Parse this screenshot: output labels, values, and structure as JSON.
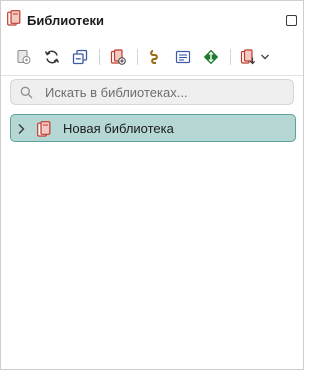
{
  "header": {
    "title": "Библиотеки",
    "icon": "library-books-icon"
  },
  "toolbar": {
    "icons": [
      "library-properties-icon",
      "sync-icon",
      "collapse-all-icon",
      "new-library-icon",
      "link-icon",
      "text-block-icon",
      "expand-diamond-icon",
      "import-library-icon"
    ]
  },
  "search": {
    "placeholder": "Искать в библиотеках...",
    "value": ""
  },
  "tree": {
    "items": [
      {
        "label": "Новая библиотека",
        "expanded": false,
        "selected": true
      }
    ]
  },
  "colors": {
    "selection_bg": "#b5d8d5",
    "selection_border": "#5d9f99",
    "book_red": "#c0392b",
    "link_brown": "#9a6a12",
    "diamond_green": "#1f7a2e",
    "toolbar_blue": "#3c5aa8"
  }
}
